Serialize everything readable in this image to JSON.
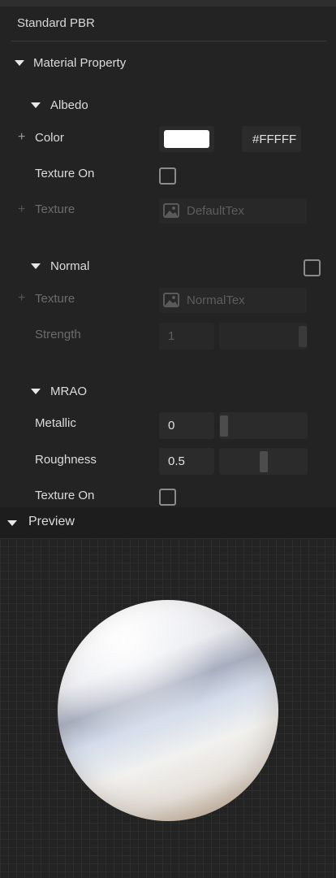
{
  "panel": {
    "title": "Standard PBR"
  },
  "material": {
    "section_label": "Material Property",
    "albedo": {
      "label": "Albedo",
      "color_label": "Color",
      "color_value": "#FFFFFF",
      "color_hex_display": "#FFFFF",
      "texture_on_label": "Texture On",
      "texture_on_checked": false,
      "texture_label": "Texture",
      "texture_value": "DefaultTex"
    },
    "normal": {
      "label": "Normal",
      "enabled": false,
      "texture_label": "Texture",
      "texture_value": "NormalTex",
      "strength_label": "Strength",
      "strength_value": "1",
      "strength_slider_fraction": 1.0
    },
    "mrao": {
      "label": "MRAO",
      "metallic_label": "Metallic",
      "metallic_value": "0",
      "metallic_slider_fraction": 0.0,
      "roughness_label": "Roughness",
      "roughness_value": "0.5",
      "roughness_slider_fraction": 0.5,
      "texture_on_label": "Texture On",
      "texture_on_checked": false
    }
  },
  "preview": {
    "label": "Preview"
  },
  "icons": {
    "expand": "triangle-down-icon",
    "add": "plus-icon",
    "texture": "image-icon"
  },
  "colors": {
    "background": "#232323",
    "swatch": "#FFFFFF"
  }
}
